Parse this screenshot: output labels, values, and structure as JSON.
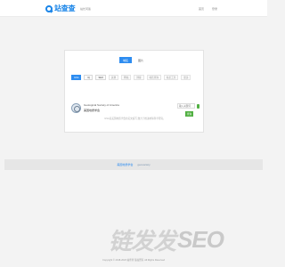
{
  "header": {
    "logo_text": "站查查",
    "nav_qa": "站长问答",
    "nav_home": "首页",
    "nav_login": "登录"
  },
  "tabs": [
    {
      "label": "域名",
      "active": true
    },
    {
      "label": "图片",
      "active": false
    }
  ],
  "type_options": [
    {
      "label": "GSA",
      "selected": true
    },
    {
      "label": "IQ",
      "selected": false
    },
    {
      "label": "SEO",
      "selected": false
    },
    {
      "label": "其他",
      "selected": false
    },
    {
      "label": "网站",
      "selected": false
    },
    {
      "label": "博客",
      "selected": false
    },
    {
      "label": "域名查询",
      "selected": false
    },
    {
      "label": "站长工具",
      "selected": false
    },
    {
      "label": "更多",
      "selected": false
    }
  ],
  "tool": {
    "title": "Geological Society of America",
    "subtitle": "美国地质学会",
    "input_placeholder": "输入关键词",
    "button_label": "查询",
    "note": "GSA是美国地质学会的英文缩写,致力于推进地球科学研究。"
  },
  "links": {
    "link_a": "美国地质学会",
    "link_b": "geosociety"
  },
  "watermark": {
    "text_cn": "链发发",
    "text_seo": "SEO"
  },
  "footer": {
    "copyright": "Copyright © 2018-2023 站查查 版权所有 All Rights Reserved"
  },
  "colors": {
    "accent": "#2d8cf0",
    "logo": "#1a85e8",
    "button_green": "#52b043"
  },
  "icons": {
    "logo": "magnifier-icon",
    "seal": "gsa-seal-icon"
  }
}
